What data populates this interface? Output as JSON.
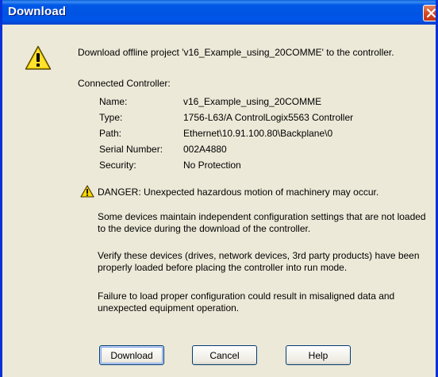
{
  "window": {
    "title": "Download"
  },
  "message": "Download offline project 'v16_Example_using_20COMME' to the controller.",
  "connected_controller": {
    "heading": "Connected Controller:",
    "fields": [
      {
        "label": "Name:",
        "value": "v16_Example_using_20COMME"
      },
      {
        "label": "Type:",
        "value": "1756-L63/A ControlLogix5563 Controller"
      },
      {
        "label": "Path:",
        "value": "Ethernet\\10.91.100.80\\Backplane\\0"
      },
      {
        "label": "Serial Number:",
        "value": "002A4880"
      },
      {
        "label": "Security:",
        "value": "No Protection"
      }
    ]
  },
  "danger": "DANGER: Unexpected hazardous motion of machinery may occur.",
  "paragraphs": [
    "Some devices maintain independent configuration settings that are not loaded to the device during the download of the controller.",
    "Verify these devices (drives, network devices, 3rd party products) have been properly loaded before placing the controller into run mode.",
    "Failure to load proper configuration could result in misaligned data and unexpected equipment operation."
  ],
  "buttons": {
    "download": "Download",
    "cancel": "Cancel",
    "help": "Help"
  },
  "colors": {
    "title_bar": "#0054E3",
    "dialog_background": "#ECE9D8",
    "warning_yellow": "#FFD700",
    "close_button": "#D5471E"
  },
  "icons": {
    "title_close": "close-icon",
    "main_warning": "warning-icon",
    "danger_warning": "warning-icon"
  }
}
